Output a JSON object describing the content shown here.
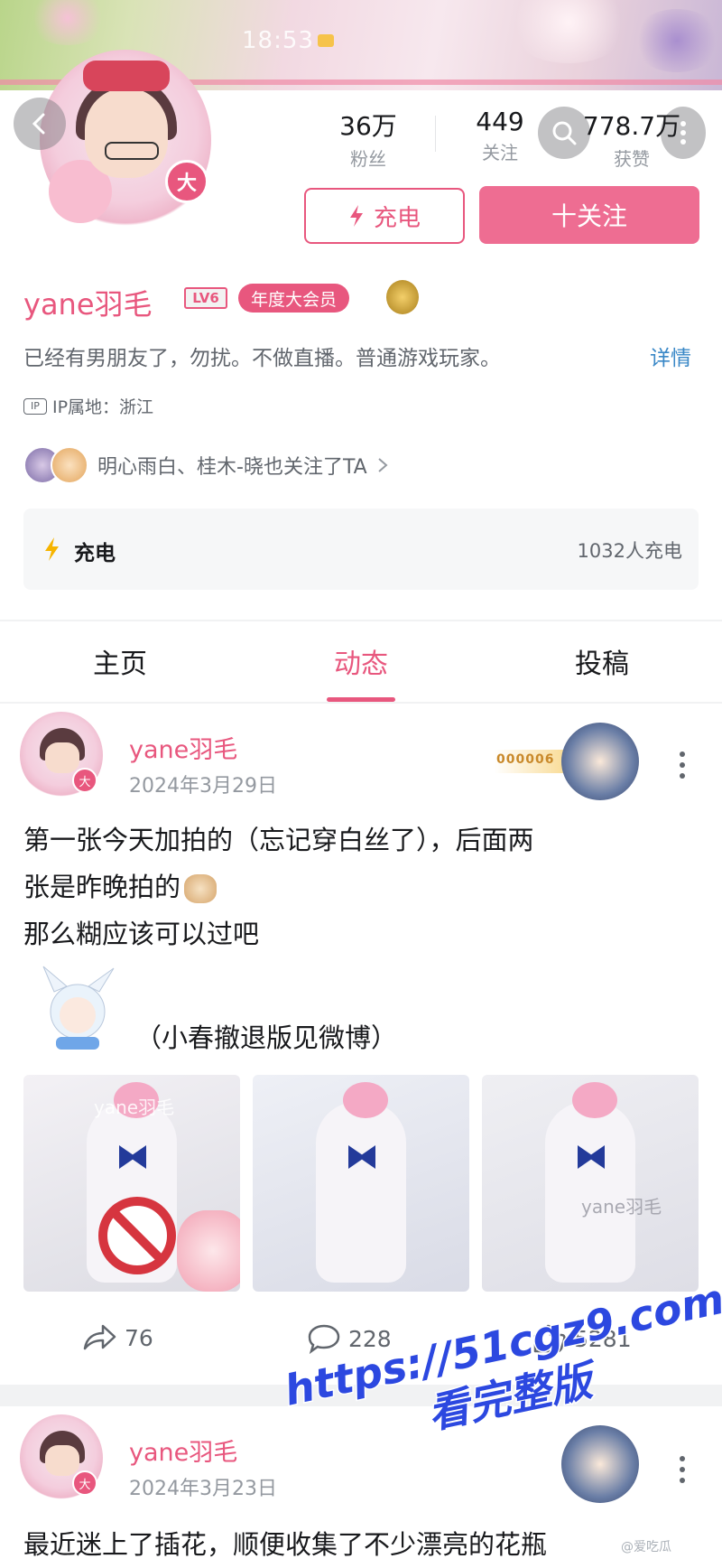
{
  "status_bar": {
    "time": "18:53"
  },
  "profile": {
    "stats": [
      {
        "value": "36万",
        "label": "粉丝"
      },
      {
        "value": "449",
        "label": "关注"
      },
      {
        "value": "778.7万",
        "label": "获赞"
      }
    ],
    "avatar_badge": "大",
    "charge_button": "充电",
    "follow_button": "十关注",
    "username": "yane羽毛",
    "level": "LV6",
    "vip": "年度大会员",
    "bio": "已经有男朋友了，勿扰。不做直播。普通游戏玩家。",
    "detail_link": "详情",
    "ip_icon": "IP",
    "ip_location": "IP属地：浙江",
    "mutual_follow": "明心雨白、桂木-晓也关注了TA",
    "charge_card": {
      "title": "充电",
      "count": "1032人充电"
    }
  },
  "tabs": [
    {
      "label": "主页",
      "active": false
    },
    {
      "label": "动态",
      "active": true
    },
    {
      "label": "投稿",
      "active": false
    }
  ],
  "posts": [
    {
      "author": "yane羽毛",
      "date": "2024年3月29日",
      "deco_code": "000006",
      "lines": [
        "第一张今天加拍的（忘记穿白丝了），后面两",
        "张是昨晚拍的",
        "那么糊应该可以过吧"
      ],
      "sticker_line": "（小春撤退版见微博）",
      "image_watermark": "yane羽毛",
      "shares": "76",
      "comments": "228",
      "likes": "5281"
    },
    {
      "author": "yane羽毛",
      "date": "2024年3月23日",
      "lines": [
        "最近迷上了插花，顺便收集了不少漂亮的花瓶"
      ]
    }
  ],
  "overlay_watermark": {
    "line1": "https://51cgz9.com",
    "line2": "看完整版"
  },
  "footer_mark": "@爱吃瓜",
  "colors": {
    "accent": "#e8577e",
    "link": "#3a88c7",
    "muted": "#9499a0"
  },
  "icons": [
    "back-icon",
    "search-icon",
    "more-icon",
    "lightning-icon",
    "share-icon",
    "comment-icon",
    "like-icon"
  ]
}
